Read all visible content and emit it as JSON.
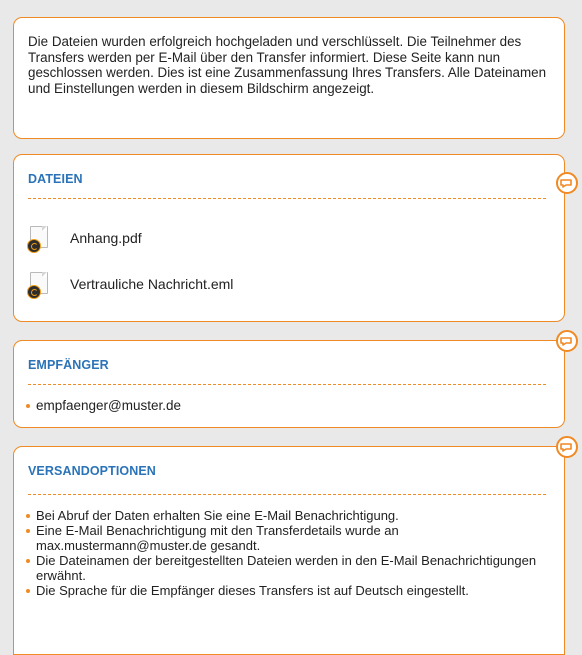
{
  "intro": {
    "text": "Die Dateien wurden erfolgreich hochgeladen und verschlüsselt. Die Teilnehmer des Transfers werden per E-Mail über den Transfer informiert. Diese Seite kann nun geschlossen werden. Dies ist eine Zusammenfassung Ihres Transfers. Alle Dateinamen und Einstellungen werden in diesem Bildschirm angezeigt."
  },
  "files": {
    "title": "DATEIEN",
    "items": [
      {
        "name": "Anhang.pdf"
      },
      {
        "name": "Vertrauliche Nachricht.eml"
      }
    ]
  },
  "recipients": {
    "title": "EMPFÄNGER",
    "items": [
      "empfaenger@muster.de"
    ]
  },
  "options": {
    "title": "VERSANDOPTIONEN",
    "items": [
      "Bei Abruf der Daten erhalten Sie eine E-Mail Benachrichtigung.",
      "Eine E-Mail Benachrichtigung mit den Transferdetails wurde an max.mustermann@muster.de gesandt.",
      "Die Dateinamen der bereitgestellten Dateien werden in den E-Mail Benachrichtigungen erwähnt.",
      "Die Sprache für die Empfänger dieses Transfers ist auf Deutsch eingestellt."
    ]
  },
  "colors": {
    "accent": "#f08a24",
    "heading": "#2b73b8",
    "background": "#e9e9e9"
  },
  "icons": {
    "file": "file-icon",
    "edit": "edit-icon"
  }
}
